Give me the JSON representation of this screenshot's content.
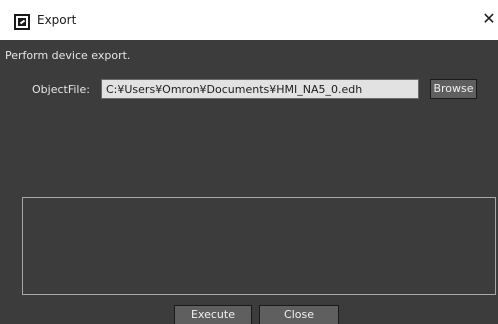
{
  "window": {
    "title": "Export",
    "close_glyph": "✕",
    "app_icon": "export-app-icon",
    "close_icon": "close-icon"
  },
  "dialog": {
    "instruction": "Perform device export.",
    "object_file_label": "ObjectFile:",
    "object_file_value": "C:¥Users¥Omron¥Documents¥HMI_NA5_0.edh",
    "browse_label": "Browse",
    "log_text": "",
    "execute_label": "Execute",
    "close_label": "Close"
  },
  "colors": {
    "panel_background": "#3c3c3c",
    "button_background": "#5f5f5f",
    "input_background": "#e2e2e2",
    "text_light": "#e6e6e6"
  }
}
